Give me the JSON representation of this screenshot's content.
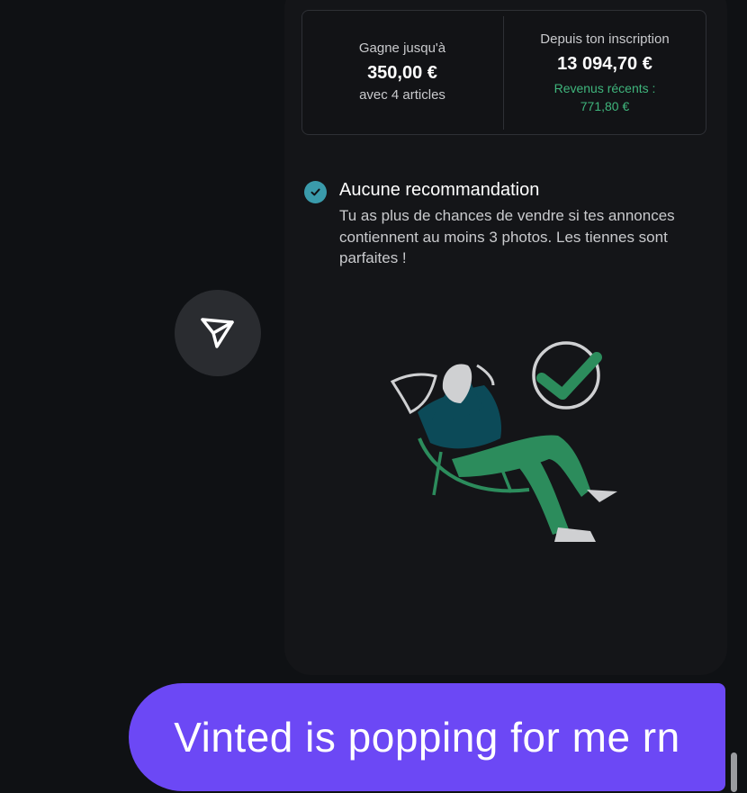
{
  "stats": {
    "left": {
      "label": "Gagne jusqu'à",
      "value": "350,00 €",
      "sub": "avec 4 articles"
    },
    "right": {
      "label": "Depuis ton inscription",
      "value": "13 094,70 €",
      "recent_label": "Revenus récents :",
      "recent_value": "771,80 €"
    }
  },
  "recommendation": {
    "title": "Aucune recommandation",
    "text": "Tu as plus de chances de vendre si tes annonces contiennent au moins 3 photos. Les tiennes sont parfaites !",
    "icon": "check-circle-icon"
  },
  "share_button": {
    "icon": "send-icon"
  },
  "illustration": {
    "icon": "relaxing-person-checkmark-illustration"
  },
  "message": {
    "text": "Vinted is popping for me rn"
  },
  "colors": {
    "background": "#0f1114",
    "card": "#141518",
    "green": "#3fb57c",
    "accent_teal": "#3a9bab",
    "bubble": "#6c48f5"
  }
}
